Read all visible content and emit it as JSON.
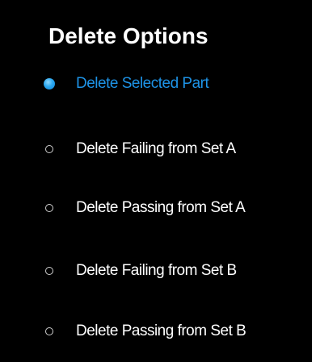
{
  "panel": {
    "title": "Delete Options"
  },
  "options": [
    {
      "label": "Delete Selected Part",
      "selected": true
    },
    {
      "label": "Delete Failing from Set A",
      "selected": false
    },
    {
      "label": "Delete Passing from Set A",
      "selected": false
    },
    {
      "label": "Delete Failing from Set B",
      "selected": false
    },
    {
      "label": "Delete Passing from Set B",
      "selected": false
    }
  ],
  "colors": {
    "background": "#000000",
    "text": "#ffffff",
    "selected_accent": "#1e93e6"
  }
}
